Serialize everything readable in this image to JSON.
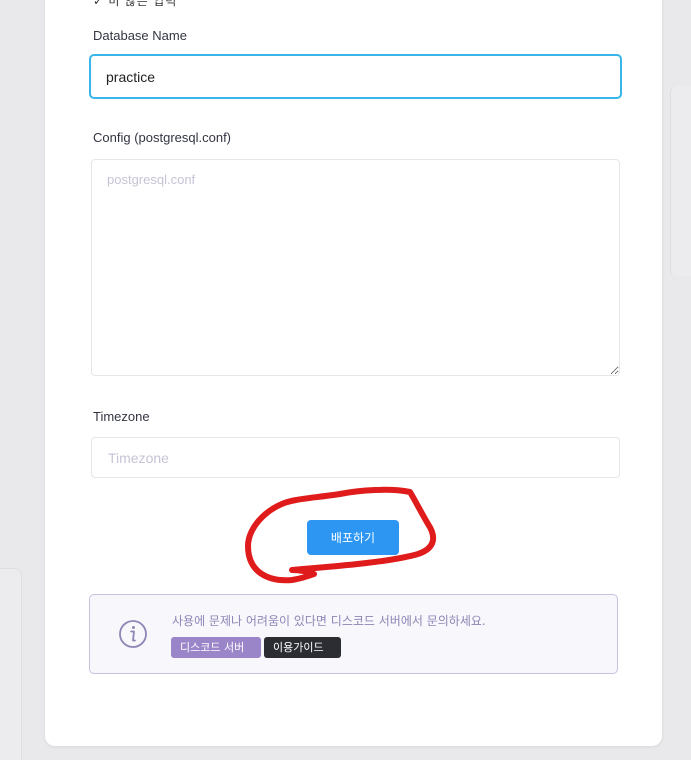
{
  "clipped_top_text": "✓ 미 않은 입력",
  "form": {
    "database_name": {
      "label": "Database Name",
      "value": "practice"
    },
    "config": {
      "label": "Config (postgresql.conf)",
      "placeholder": "postgresql.conf",
      "value": ""
    },
    "timezone": {
      "label": "Timezone",
      "placeholder": "Timezone",
      "value": ""
    },
    "submit_label": "배포하기"
  },
  "info": {
    "icon": "info-circle-icon",
    "message": "사용에 문제나 어려움이 있다면 디스코드 서버에서 문의하세요.",
    "discord_label": "디스코드 서버",
    "guide_label": "이용가이드"
  },
  "colors": {
    "accent": "#2d96f2",
    "focus_border": "#38b6ea",
    "annotation": "#e01b1b",
    "discord_tag": "#9b85c9",
    "guide_tag": "#2c2c33",
    "info_border": "#c9c0e2"
  }
}
